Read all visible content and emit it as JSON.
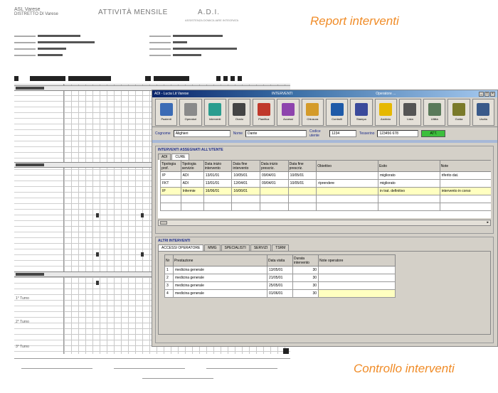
{
  "captions": {
    "report": "Report interventi",
    "controllo": "Controllo interventi"
  },
  "paper": {
    "header_left": "ASL Varese",
    "header_left_sub": "DISTRETTO DI Varese",
    "title": "ATTIVITÀ MENSILE",
    "adi": "A.D.I.",
    "adi_sub": "ASSISTENZA DOMICILIARE INTEGRATA",
    "sections": [
      "INTERVENTI",
      "INTERVENTI",
      "NURSING"
    ],
    "shifts": [
      "1° Turno",
      "2° Turno",
      "3° Turno"
    ]
  },
  "window": {
    "title": "ADI - Lucia Lit Varese",
    "title_center": "INTERVENTI",
    "title_right": "Operatore ...",
    "toolbar": [
      {
        "label": "Pazienti",
        "icon": "people-icon",
        "color": "#3b6bb5"
      },
      {
        "label": "Operatori",
        "icon": "operator-icon",
        "color": "#8a8a8a"
      },
      {
        "label": "Interventi",
        "icon": "diamond-icon",
        "color": "#2a9d8f"
      },
      {
        "label": "Orario",
        "icon": "clock-icon",
        "color": "#444444"
      },
      {
        "label": "Pianifica",
        "icon": "calendar-icon",
        "color": "#c0392b"
      },
      {
        "label": "Accessi",
        "icon": "paint-icon",
        "color": "#8e44ad"
      },
      {
        "label": "Chiusura",
        "icon": "folder-icon",
        "color": "#d49b2a"
      },
      {
        "label": "Controlli",
        "icon": "chart-icon",
        "color": "#1e5aa8"
      },
      {
        "label": "Stampa",
        "icon": "print-icon",
        "color": "#3b4a9b"
      },
      {
        "label": "Archivio",
        "icon": "light-icon",
        "color": "#e6b800"
      },
      {
        "label": "Lista",
        "icon": "list-icon",
        "color": "#555555"
      },
      {
        "label": "Utilità",
        "icon": "tools-icon",
        "color": "#5a7a5a"
      },
      {
        "label": "Guida",
        "icon": "help-icon",
        "color": "#7a7a2a"
      },
      {
        "label": "Uscita",
        "icon": "exit-icon",
        "color": "#3a5a8a"
      }
    ],
    "patient": {
      "cognome_label": "Cognome",
      "cognome": "Alighieri",
      "nome_label": "Nome",
      "nome": "Dante",
      "codice_label": "Codice utente",
      "codice": "1234",
      "tesserino_label": "Tesserino",
      "tesserino": "123456 678",
      "stato": "ATT."
    },
    "interventi": {
      "title": "INTERVENTI ASSEGNATI ALL'UTENTE",
      "tabs": [
        "ADI",
        "CURE"
      ],
      "columns": [
        "Tipologia prof.",
        "Tipologia servizio",
        "Data inizio intervento",
        "Data fine intervento",
        "Data inizio prescriz.",
        "Data fine prescriz.",
        "Obiettivo",
        "Esito",
        "Note"
      ],
      "rows": [
        [
          "IP",
          "ADI",
          "13/01/01",
          "10/05/01",
          "09/04/01",
          "10/05/01",
          "",
          "migliorato",
          "riferito dat."
        ],
        [
          "FKT",
          "ADI",
          "13/01/01",
          "12/04/01",
          "09/04/01",
          "10/05/01",
          "riprendere",
          "migliorato",
          ""
        ],
        [
          "IP",
          "Infermie",
          "16/06/01",
          "16/06/01",
          "",
          "",
          "",
          "in trat. definitivo",
          "intervento in corso"
        ]
      ]
    },
    "altri": {
      "title": "ALTRI INTERVENTI",
      "tabs": [
        "ACCESSI OPERATORE",
        "MMG",
        "SPECIALISTI",
        "SERVIZI",
        "TSRM"
      ],
      "columns": [
        "Nr",
        "Prestazione",
        "Data visita",
        "Durata intervento",
        "Note operatore"
      ],
      "rows": [
        [
          "1",
          "medicina generale",
          "13/05/01",
          "30",
          ""
        ],
        [
          "2",
          "medicina generale",
          "21/05/01",
          "30",
          ""
        ],
        [
          "3",
          "medicina generale",
          "25/05/01",
          "30",
          ""
        ],
        [
          "4",
          "medicina generale",
          "01/06/01",
          "30",
          ""
        ]
      ]
    }
  }
}
